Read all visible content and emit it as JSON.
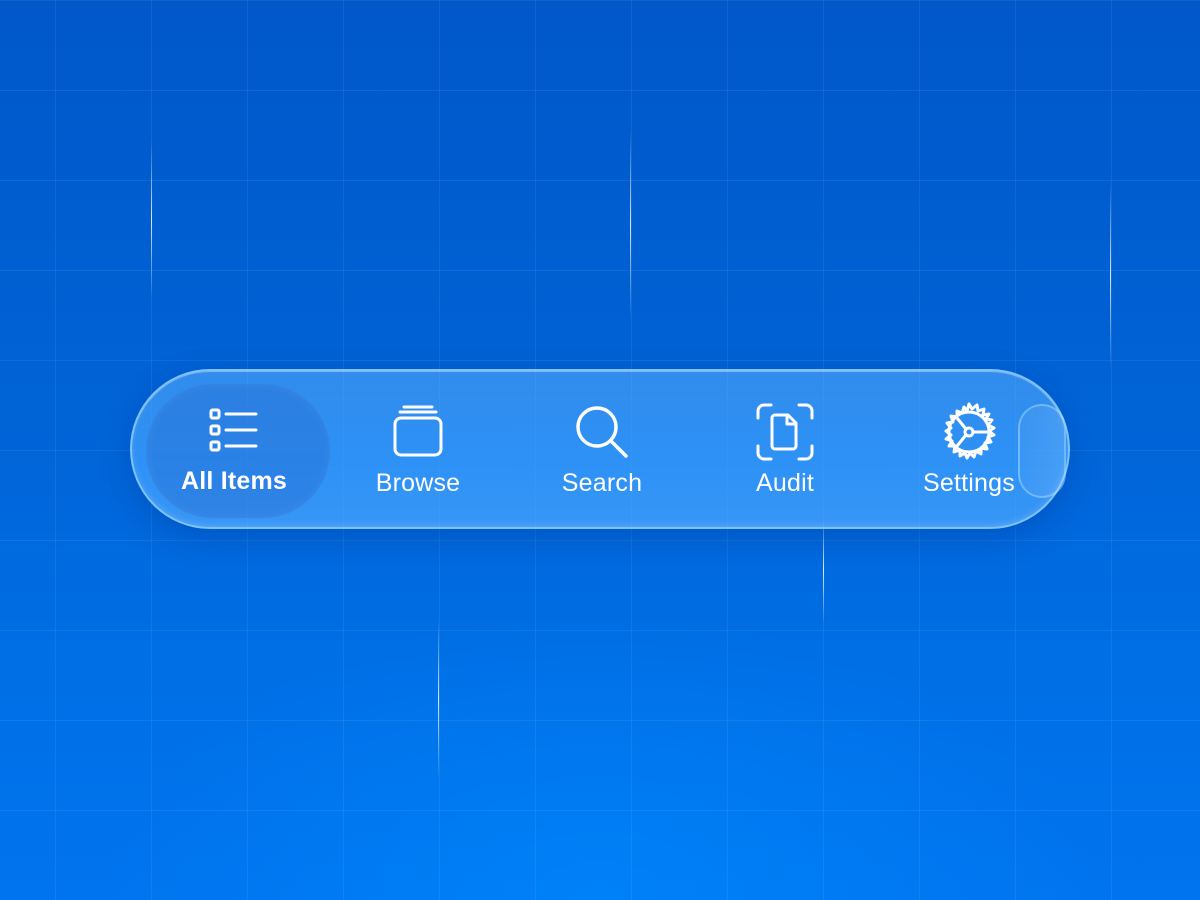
{
  "tab_bar": {
    "active_tab": "All Items",
    "tabs": [
      {
        "id": "all-items",
        "label": "All Items",
        "icon": "list-icon"
      },
      {
        "id": "browse",
        "label": "Browse",
        "icon": "stacked-folders-icon"
      },
      {
        "id": "search",
        "label": "Search",
        "icon": "magnifying-glass-icon"
      },
      {
        "id": "audit",
        "label": "Audit",
        "icon": "document-scan-icon"
      },
      {
        "id": "settings",
        "label": "Settings",
        "icon": "gear-icon"
      }
    ]
  },
  "colors": {
    "background": "#0063d6",
    "tab_bar_fill": "#3ca0ff",
    "tab_bar_border": "#96d2ff",
    "active_pill": "#286ed2",
    "text": "#ffffff"
  }
}
